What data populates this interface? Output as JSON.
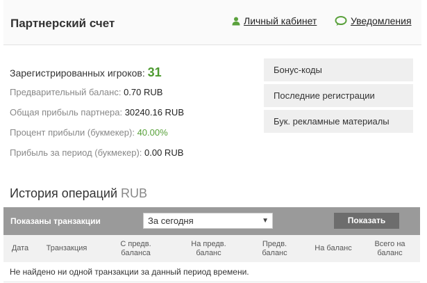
{
  "header": {
    "title": "Партнерский счет",
    "cabinet_link": "Личный кабинет",
    "notifications_link": "Уведомления"
  },
  "stats": {
    "registered_label": "Зарегистрированных игроков:",
    "registered_count": "31",
    "prelim_balance_label": "Предварительный баланс:",
    "prelim_balance_value": "0.70 RUB",
    "total_profit_label": "Общая прибыль партнера:",
    "total_profit_value": "30240.16 RUB",
    "profit_percent_label": "Процент прибыли (букмекер):",
    "profit_percent_value": "40.00%",
    "period_profit_label": "Прибыль за период (букмекер):",
    "period_profit_value": "0.00 RUB"
  },
  "side_menu": {
    "items": [
      {
        "label": "Бонус-коды"
      },
      {
        "label": "Последние регистрации"
      },
      {
        "label": "Бук. рекламные материалы"
      }
    ]
  },
  "history": {
    "title": "История операций",
    "currency": "RUB",
    "filter_label": "Показаны транзакции",
    "period_selected": "За сегодня",
    "show_button": "Показать",
    "columns": [
      {
        "line1": "Дата",
        "line2": ""
      },
      {
        "line1": "Транзакция",
        "line2": ""
      },
      {
        "line1": "С предв.",
        "line2": "баланса"
      },
      {
        "line1": "На предв.",
        "line2": "баланс"
      },
      {
        "line1": "Предв.",
        "line2": "баланс"
      },
      {
        "line1": "На баланс",
        "line2": ""
      },
      {
        "line1": "Всего на",
        "line2": "баланс"
      }
    ],
    "empty_message": "Не найдено ни одной транзакции за данный период времени."
  },
  "colors": {
    "accent_green": "#58a13a",
    "filter_bar": "#9a9a9a",
    "button": "#6d6d6d"
  },
  "icons": {
    "cabinet": "user-icon",
    "notifications": "speech-bubble-icon",
    "dropdown": "triangle-down-icon"
  }
}
